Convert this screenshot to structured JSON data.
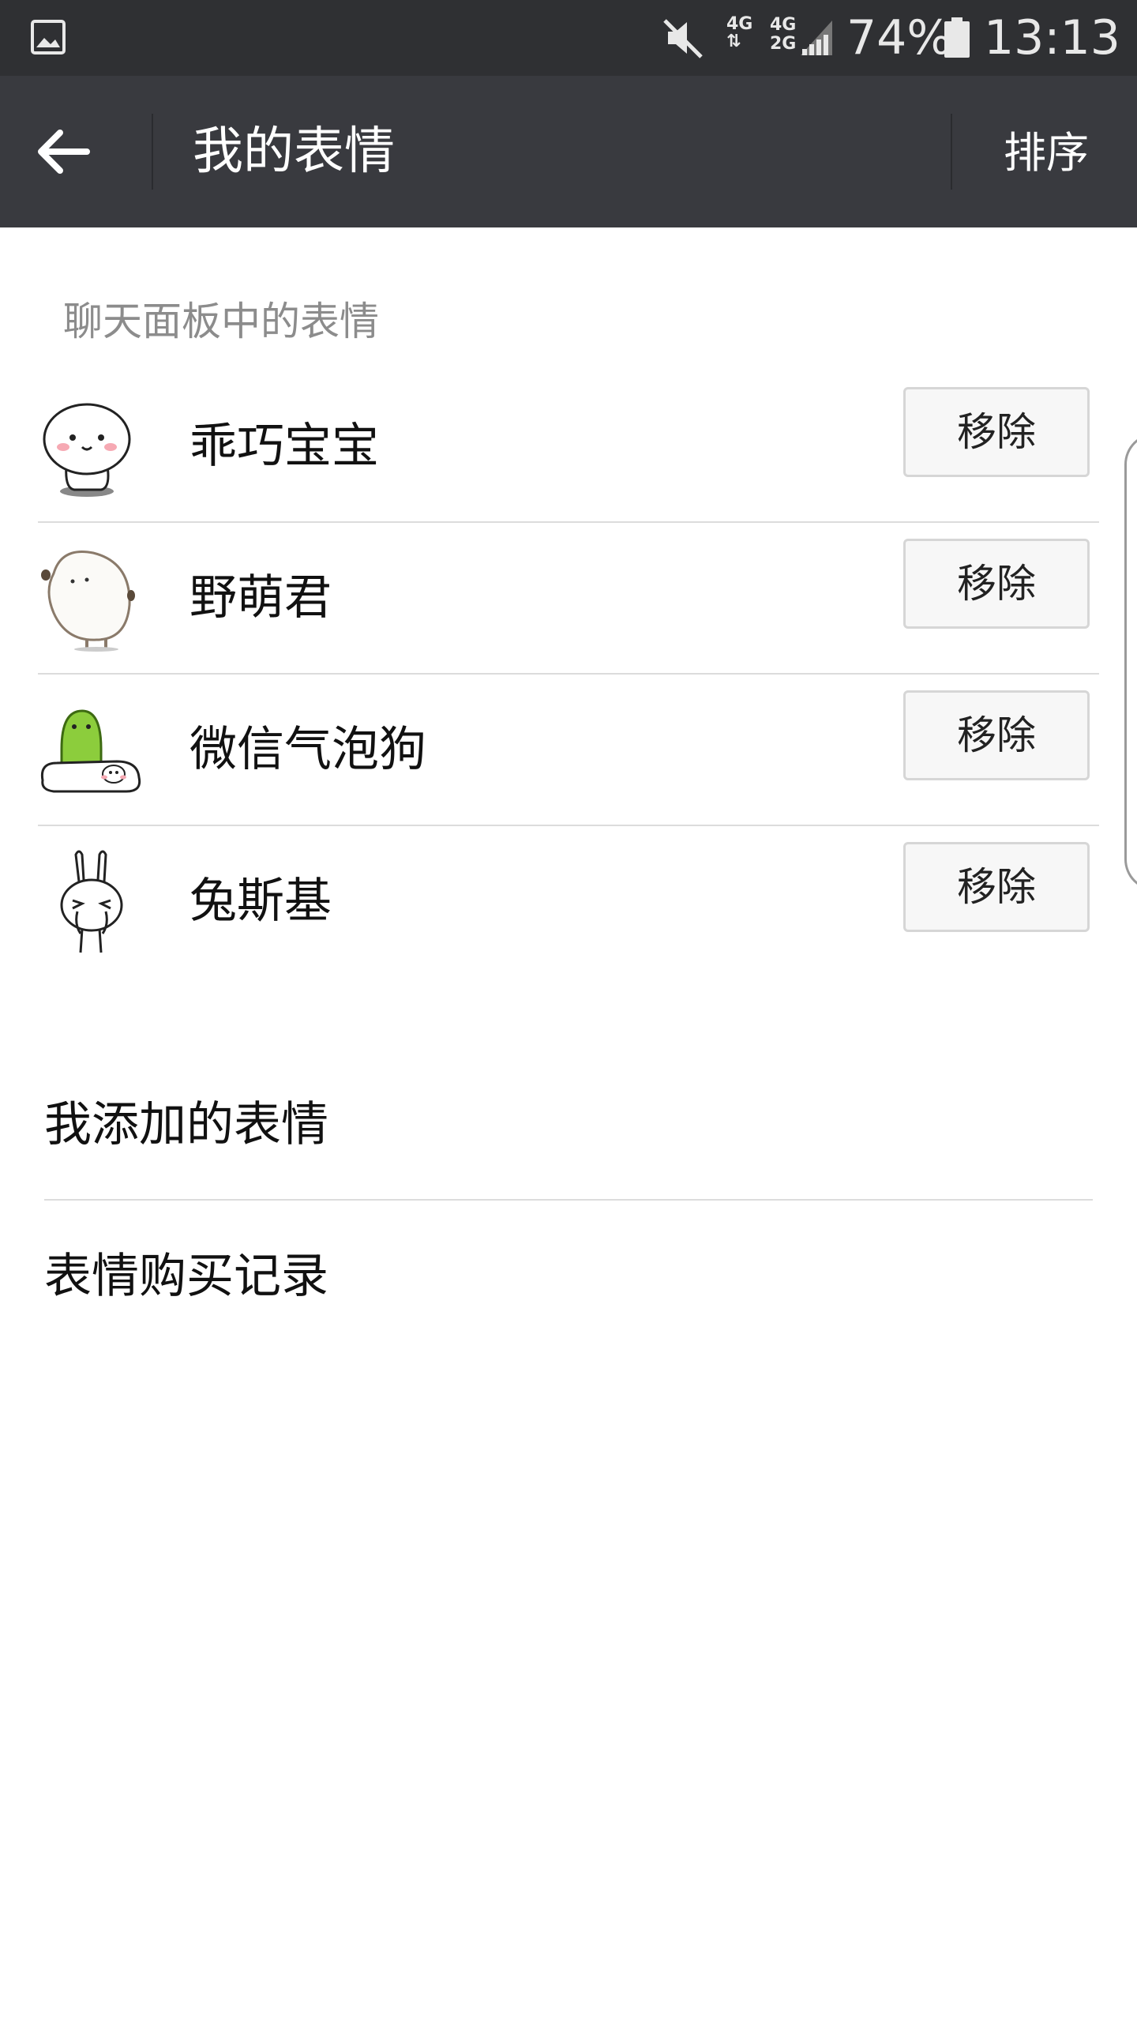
{
  "status_bar": {
    "icons": [
      "gallery-icon",
      "mute-icon",
      "signal-icon",
      "battery-icon"
    ],
    "network_top": "4G",
    "network_bottom_a": "4G",
    "network_bottom_b": "2G",
    "battery": "74%",
    "time": "13:13"
  },
  "header": {
    "title": "我的表情",
    "sort_label": "排序"
  },
  "section": {
    "title": "聊天面板中的表情"
  },
  "stickers": [
    {
      "name": "乖巧宝宝",
      "action": "移除",
      "icon": "sticker-baby-icon"
    },
    {
      "name": "野萌君",
      "action": "移除",
      "icon": "sticker-potato-icon"
    },
    {
      "name": "微信气泡狗",
      "action": "移除",
      "icon": "sticker-dog-icon"
    },
    {
      "name": "兔斯基",
      "action": "移除",
      "icon": "sticker-rabbit-icon"
    }
  ],
  "menu": {
    "added": "我添加的表情",
    "purchase_history": "表情购买记录"
  },
  "colors": {
    "status_bar_bg": "#2f3033",
    "app_bar_bg": "#393a3f",
    "accent_green": "#8ccd3c"
  }
}
